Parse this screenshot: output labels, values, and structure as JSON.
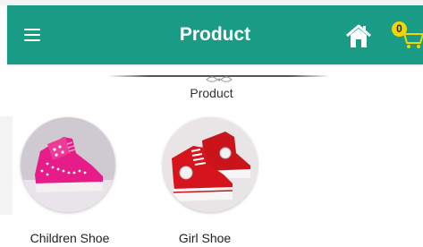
{
  "appbar": {
    "title": "Product",
    "menu_icon": "hamburger-menu-icon",
    "home_icon": "home-icon",
    "cart_icon": "shopping-cart-icon",
    "cart_count": "0",
    "background_color": "#1a9b86",
    "badge_color": "#f2d602"
  },
  "section": {
    "title": "Product"
  },
  "products": [
    {
      "name": "Children Shoe",
      "image": "pink-high-top-sneaker"
    },
    {
      "name": "Girl Shoe",
      "image": "red-high-top-sneakers"
    }
  ]
}
